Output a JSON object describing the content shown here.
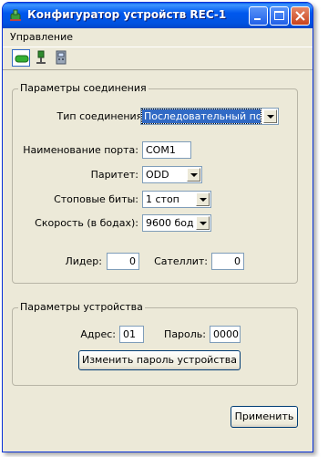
{
  "window": {
    "title": "Конфигуратор устройств REC-1"
  },
  "menu": {
    "items": [
      "Управление"
    ]
  },
  "toolbar": {
    "tools": [
      {
        "icon": "connection-icon",
        "active": true
      },
      {
        "icon": "device-icon",
        "active": false
      },
      {
        "icon": "settings-icon",
        "active": false
      }
    ]
  },
  "connection": {
    "legend": "Параметры соединения",
    "type_label": "Тип соединения:",
    "type_value": "Последовательный порт",
    "port_label": "Наименование порта:",
    "port_value": "COM1",
    "parity_label": "Паритет:",
    "parity_value": "ODD",
    "stopbits_label": "Стоповые биты:",
    "stopbits_value": "1 стоп",
    "baud_label": "Скорость (в бодах):",
    "baud_value": "9600 бод",
    "leader_label": "Лидер:",
    "leader_value": "0",
    "satellite_label": "Сателлит:",
    "satellite_value": "0"
  },
  "device": {
    "legend": "Параметры устройства",
    "address_label": "Адрес:",
    "address_value": "01",
    "password_label": "Пароль:",
    "password_value": "0000",
    "change_password_label": "Изменить пароль устройства"
  },
  "footer": {
    "apply_label": "Применить"
  },
  "colors": {
    "titlebar": "#0058ee",
    "window_bg": "#ece9d8",
    "selection": "#316ac5"
  }
}
